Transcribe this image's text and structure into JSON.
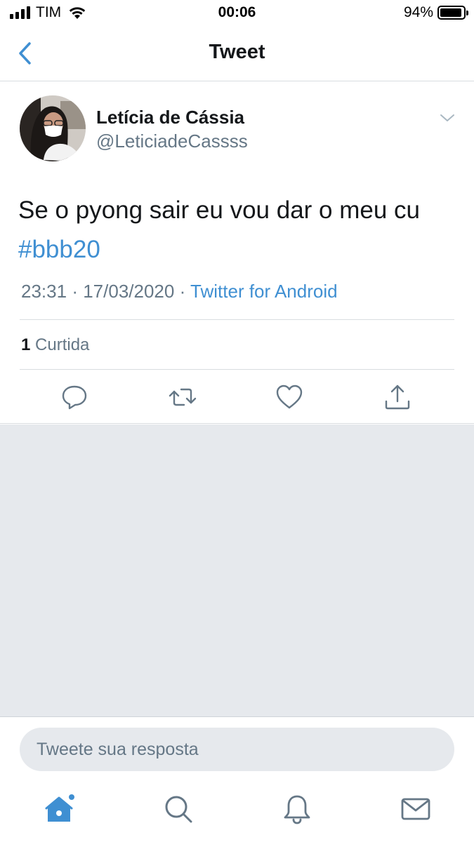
{
  "status_bar": {
    "carrier": "TIM",
    "time": "00:06",
    "battery": "94%",
    "battery_level": 0.94
  },
  "nav": {
    "title": "Tweet",
    "back_icon": "chevron-left-icon"
  },
  "tweet": {
    "author_name": "Letícia de Cássia",
    "author_handle": "@LeticiadeCassss",
    "text": "Se o pyong sair eu vou dar o meu cu",
    "hashtag": "#bbb20",
    "time": "23:31",
    "date": "17/03/2020",
    "sep": "·",
    "source": "Twitter for Android",
    "likes_count": "1",
    "likes_label": "Curtida"
  },
  "reply": {
    "placeholder": "Tweete sua resposta"
  },
  "colors": {
    "accent": "#3f8fd2",
    "secondary_text": "#657786",
    "background_gray": "#e6e9ed"
  },
  "tabs": [
    "home-icon",
    "search-icon",
    "bell-icon",
    "mail-icon"
  ]
}
